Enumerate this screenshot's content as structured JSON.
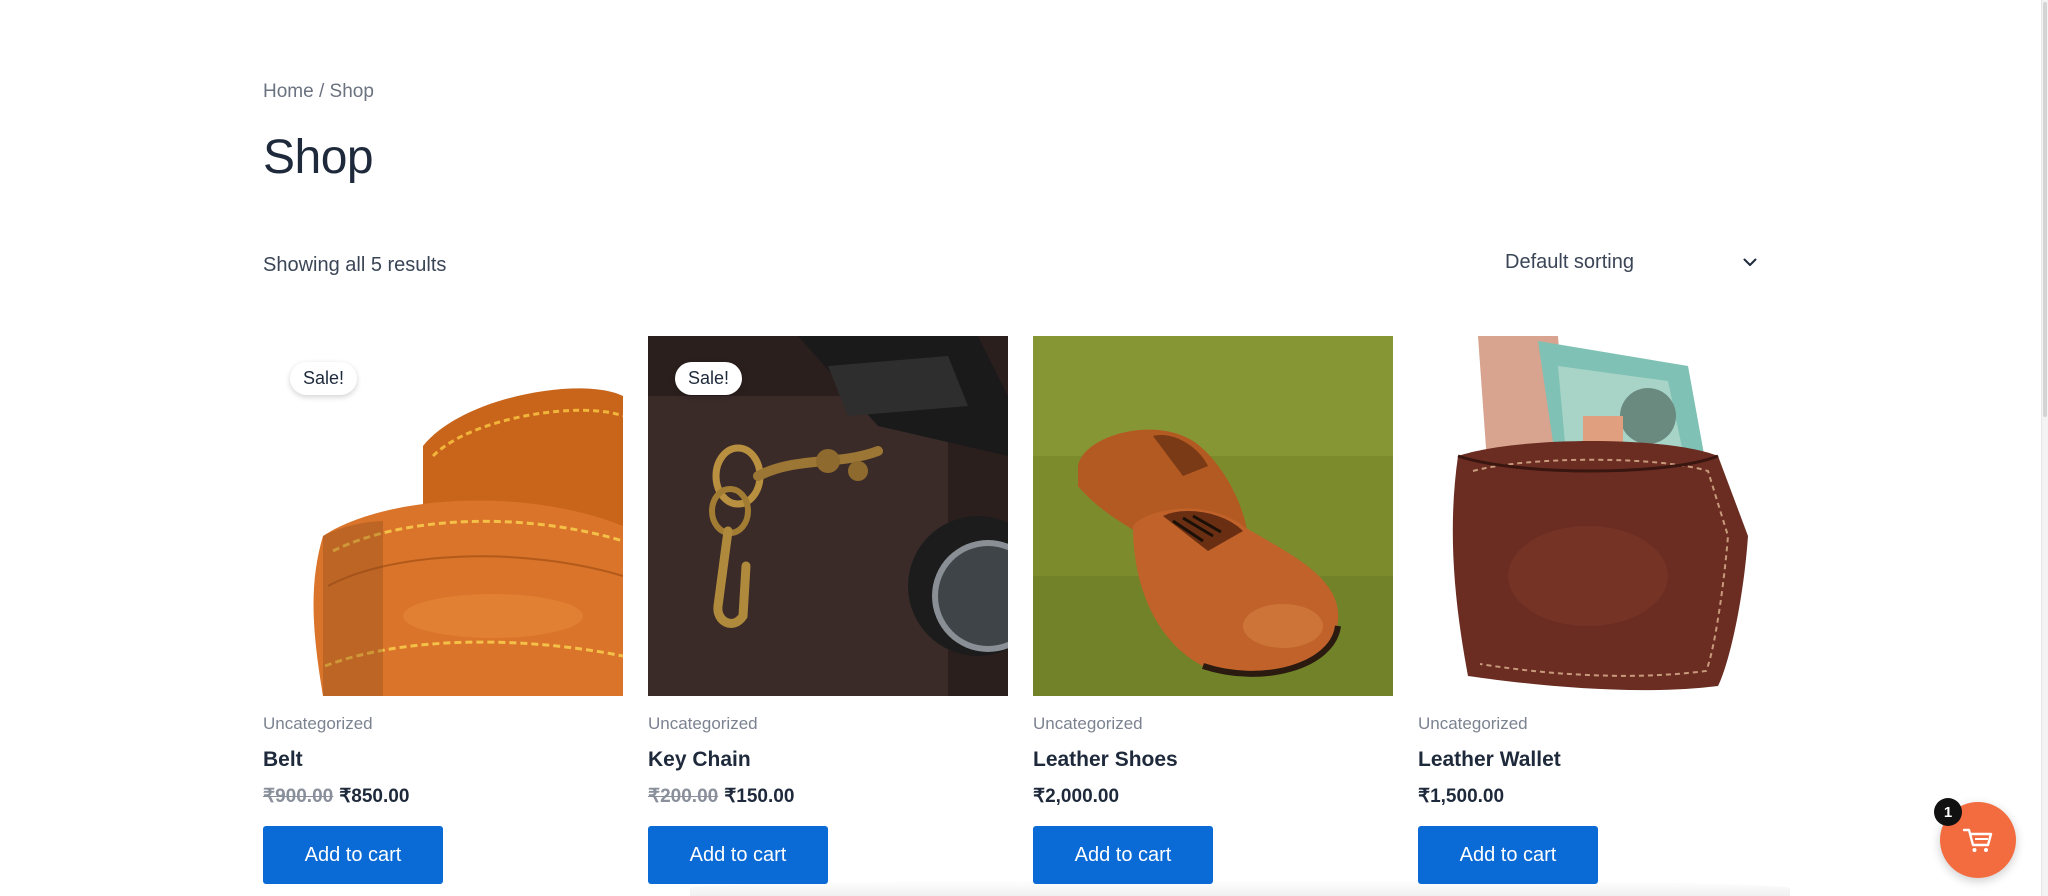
{
  "breadcrumb": {
    "home": "Home",
    "separator": " / ",
    "current": "Shop"
  },
  "page_title": "Shop",
  "result_count": "Showing all 5 results",
  "sorting": {
    "selected": "Default sorting",
    "icon": "chevron-down-icon"
  },
  "products": [
    {
      "name": "Belt",
      "category": "Uncategorized",
      "sale_badge": "Sale!",
      "regular_price": "₹900.00",
      "price": "₹850.00",
      "button": "Add to cart"
    },
    {
      "name": "Key Chain",
      "category": "Uncategorized",
      "sale_badge": "Sale!",
      "regular_price": "₹200.00",
      "price": "₹150.00",
      "button": "Add to cart"
    },
    {
      "name": "Leather Shoes",
      "category": "Uncategorized",
      "price": "₹2,000.00",
      "button": "Add to cart"
    },
    {
      "name": "Leather Wallet",
      "category": "Uncategorized",
      "price": "₹1,500.00",
      "button": "Add to cart"
    }
  ],
  "cart": {
    "count": "1",
    "icon": "cart-icon",
    "color": "#f26c3f"
  },
  "colors": {
    "button": "#0a6ad6",
    "text": "#1e2a3b",
    "muted": "#7b8290"
  }
}
